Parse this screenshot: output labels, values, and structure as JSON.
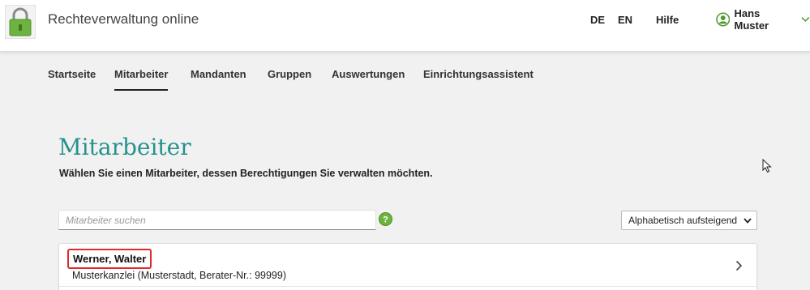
{
  "header": {
    "app_title": "Rechteverwaltung online",
    "languages": [
      "DE",
      "EN"
    ],
    "help_label": "Hilfe",
    "user_name": "Hans Muster",
    "logo_icon": "padlock-icon",
    "accent_color": "#6db33f"
  },
  "nav": {
    "items": [
      {
        "label": "Startseite",
        "active": false
      },
      {
        "label": "Mitarbeiter",
        "active": true
      },
      {
        "label": "Mandanten",
        "active": false
      },
      {
        "label": "Gruppen",
        "active": false
      },
      {
        "label": "Auswertungen",
        "active": false
      },
      {
        "label": "Einrichtungsassistent",
        "active": false
      }
    ]
  },
  "main": {
    "title": "Mitarbeiter",
    "title_color": "#25928c",
    "subtitle": "Wählen Sie einen Mitarbeiter, dessen Berechtigungen Sie verwalten möchten.",
    "search": {
      "value": "",
      "placeholder": "Mitarbeiter suchen"
    },
    "sort": {
      "selected": "Alphabetisch aufsteigend"
    },
    "employees": [
      {
        "name": "Werner, Walter",
        "details": "Musterkanzlei (Musterstadt, Berater-Nr.: 99999)",
        "highlight_color": "#e02a2a"
      }
    ]
  }
}
